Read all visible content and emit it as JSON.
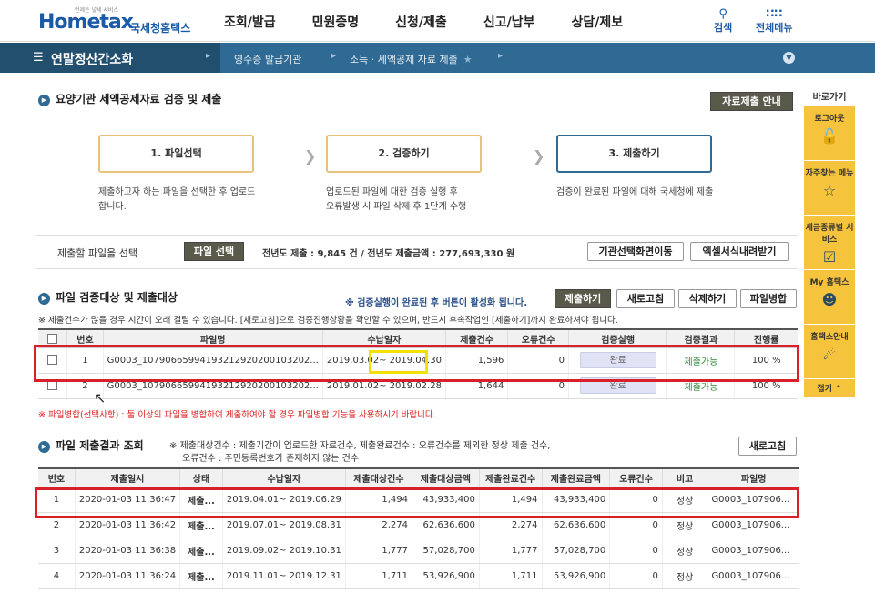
{
  "header": {
    "logo": "Hometax",
    "logo_sub": "국세청홈택스",
    "logo_tag": "언제든 넣세 서비스",
    "nav": [
      "조회/발급",
      "민원증명",
      "신청/제출",
      "신고/납부",
      "상담/제보"
    ],
    "search_label": "검색",
    "all_menu_label": "전체메뉴"
  },
  "subnav": {
    "menu": "연말정산간소화",
    "crumb1": "영수증 발급기관",
    "crumb2": "소득 · 세액공제 자료 제출"
  },
  "quick": {
    "title": "바로가기",
    "items": [
      "로그아웃",
      "자주찾는 메뉴",
      "세금종류별 서비스",
      "My 홈택스",
      "홈택스안내"
    ],
    "close": "접기 ^"
  },
  "section1": {
    "title": "요양기관 세액공제자료 검증 및 제출",
    "guide_button": "자료제출 안내",
    "steps": [
      "1. 파일선택",
      "2. 검증하기",
      "3. 제출하기"
    ],
    "step_desc": [
      [
        "제출하고자 하는 파일을 선택한 후 업로드",
        "합니다."
      ],
      [
        "업로드된 파일에 대한 검증 실행 후",
        "오류발생 시 파일 삭제 후 1단계 수행"
      ],
      [
        "검증이 완료된 파일에 대해 국세청에 제출"
      ]
    ],
    "file_select_label": "제출할 파일을 선택",
    "file_select_button": "파일 선택",
    "prev_year_text": "전년도 제출 : 9,845 건 / 전년도 제출금액 : 277,693,330 원",
    "org_button": "기관선택화면이동",
    "excel_button": "엑셀서식내려받기"
  },
  "section2": {
    "title": "파일 검증대상 및 제출대상",
    "hint": "※ 검증실행이 완료된 후 버튼이 활성화 됩니다.",
    "buttons": [
      "제출하기",
      "새로고침",
      "삭제하기",
      "파일병합"
    ],
    "warn": "※ 제출건수가 많을 경우 시간이 오래 걸릴 수 있습니다. [새로고침]으로 검증진행상황을 확인할 수 있으며, 반드시 후속작업인 [제출하기]까지 완료하셔야 됩니다.",
    "headers": [
      "번호",
      "파일명",
      "수납일자",
      "제출건수",
      "오류건수",
      "검증실행",
      "검증결과",
      "진행률"
    ],
    "rows": [
      {
        "no": "1",
        "file": "G0003_10790665994193212920200103202...",
        "date_from": "2019.03.02~",
        "date_to": "2019.04.30",
        "count": "1,596",
        "errors": "0",
        "run": "완료",
        "result": "제출가능",
        "progress": "100 %"
      },
      {
        "no": "2",
        "file": "G0003_10790665994193212920200103202...",
        "date_from": "2019.01.02~",
        "date_to": "2019.02.28",
        "count": "1,644",
        "errors": "0",
        "run": "완료",
        "result": "제출가능",
        "progress": "100 %"
      }
    ],
    "merge_note": "※ 파일병합(선택사항) : 둘 이상의 파일을 병합하여 제출하여야 할 경우 파일병합 기능을 사용하시기 바랍니다."
  },
  "section3": {
    "title": "파일 제출결과 조회",
    "desc1": "※ 제출대상건수 : 제출기간이 업로드한 자료건수, 제출완료건수 : 오류건수를 제외한 정상 제출 건수,",
    "desc2": "오류건수 : 주민등록번호가 존재하지 않는 건수",
    "refresh": "새로고침",
    "headers": [
      "번호",
      "제출일시",
      "상태",
      "수납일자",
      "제출대상건수",
      "제출대상금액",
      "제출완료건수",
      "제출완료금액",
      "오류건수",
      "비고",
      "파일명"
    ],
    "rows": [
      {
        "no": "1",
        "datetime": "2020-01-03 11:36:47",
        "status": "제출...",
        "period": "2019.04.01~ 2019.06.29",
        "target_count": "1,494",
        "target_amount": "43,933,400",
        "done_count": "1,494",
        "done_amount": "43,933,400",
        "errors": "0",
        "remark": "정상",
        "file": "G0003_107906..."
      },
      {
        "no": "2",
        "datetime": "2020-01-03 11:36:42",
        "status": "제출...",
        "period": "2019.07.01~ 2019.08.31",
        "target_count": "2,274",
        "target_amount": "62,636,600",
        "done_count": "2,274",
        "done_amount": "62,636,600",
        "errors": "0",
        "remark": "정상",
        "file": "G0003_107906..."
      },
      {
        "no": "3",
        "datetime": "2020-01-03 11:36:38",
        "status": "제출...",
        "period": "2019.09.02~ 2019.10.31",
        "target_count": "1,777",
        "target_amount": "57,028,700",
        "done_count": "1,777",
        "done_amount": "57,028,700",
        "errors": "0",
        "remark": "정상",
        "file": "G0003_107906..."
      },
      {
        "no": "4",
        "datetime": "2020-01-03 11:36:24",
        "status": "제출...",
        "period": "2019.11.01~ 2019.12.31",
        "target_count": "1,711",
        "target_amount": "53,926,900",
        "done_count": "1,711",
        "done_amount": "53,926,900",
        "errors": "0",
        "remark": "정상",
        "file": "G0003_107906..."
      }
    ]
  },
  "colors": {
    "brand": "#1b5aa6",
    "subnav": "#2f6a94",
    "quick": "#f6c33d",
    "highlight_red": "#d9202a",
    "highlight_yellow": "#f2e100",
    "ok_green": "#2e8b3a"
  }
}
